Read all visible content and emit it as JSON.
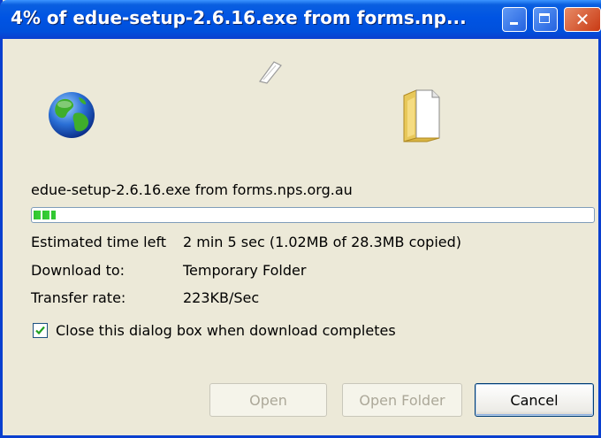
{
  "window": {
    "title": "4% of edue-setup-2.6.16.exe from forms.np...",
    "close_glyph": "✕"
  },
  "icons": {
    "source": "globe-icon",
    "transfer": "paper-icon",
    "destination": "folder-icon"
  },
  "download": {
    "source_line": "edue-setup-2.6.16.exe from forms.nps.org.au",
    "progress_fraction": 0.04,
    "estimated_label": "Estimated time left",
    "estimated_value": "2 min 5 sec (1.02MB of 28.3MB copied)",
    "download_to_label": "Download to:",
    "download_to_value": "Temporary Folder",
    "transfer_rate_label": "Transfer rate:",
    "transfer_rate_value": "223KB/Sec"
  },
  "options": {
    "close_when_complete_label": "Close this dialog box when download completes",
    "close_when_complete_checked": true
  },
  "buttons": {
    "open": "Open",
    "open_folder": "Open Folder",
    "cancel": "Cancel"
  },
  "colors": {
    "titlebar": "#0054e3",
    "progress": "#2ec32e",
    "dialog_bg": "#ece9d8"
  }
}
